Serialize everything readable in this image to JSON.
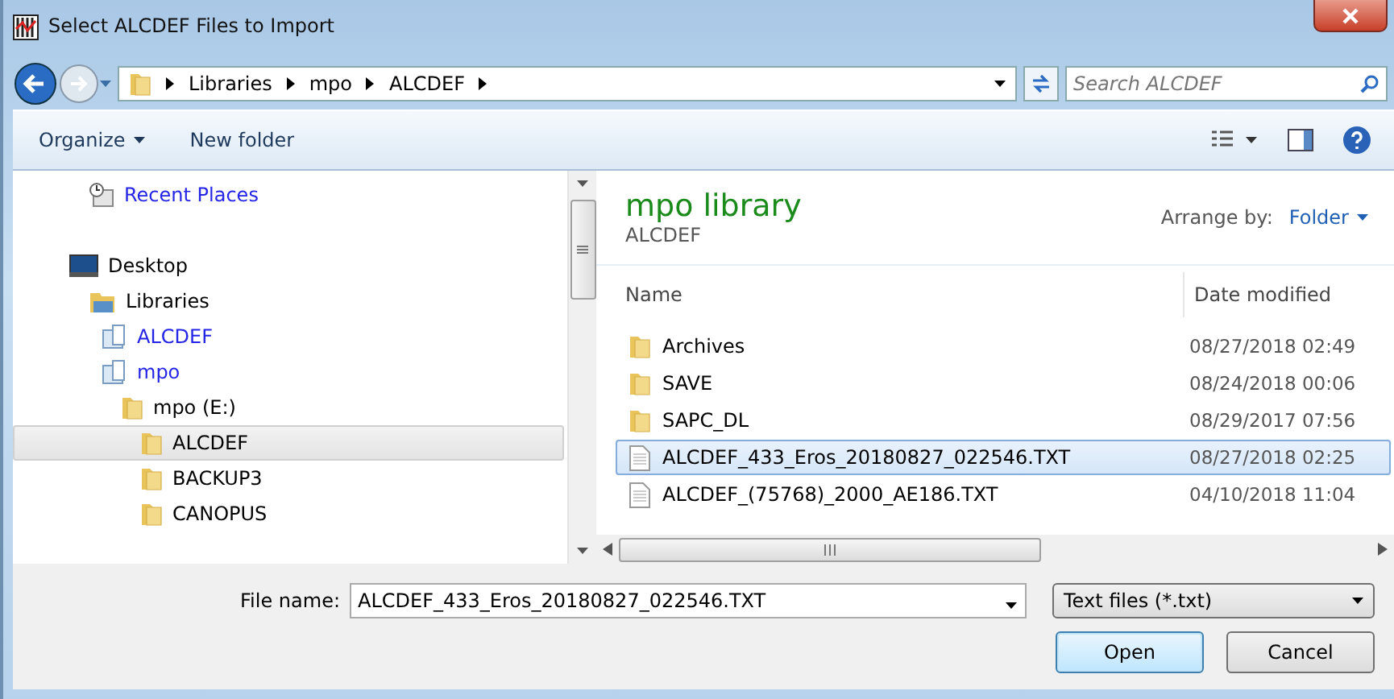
{
  "window": {
    "title": "Select ALCDEF Files to Import"
  },
  "address": {
    "segments": [
      "Libraries",
      "mpo",
      "ALCDEF"
    ]
  },
  "search": {
    "placeholder": "Search ALCDEF"
  },
  "toolbar": {
    "organize": "Organize",
    "new_folder": "New folder"
  },
  "nav_tree": [
    {
      "label": "Recent Places",
      "kind": "recent",
      "selected": false
    },
    {
      "label": "Desktop",
      "kind": "desktop",
      "selected": false,
      "children": [
        {
          "label": "Libraries",
          "kind": "libraries",
          "selected": false,
          "children": [
            {
              "label": "ALCDEF",
              "kind": "library",
              "selected": false
            },
            {
              "label": "mpo",
              "kind": "library",
              "selected": false,
              "children": [
                {
                  "label": "mpo (E:)",
                  "kind": "folder",
                  "selected": false,
                  "children": [
                    {
                      "label": "ALCDEF",
                      "kind": "folder",
                      "selected": true
                    },
                    {
                      "label": "BACKUP3",
                      "kind": "folder",
                      "selected": false
                    },
                    {
                      "label": "CANOPUS",
                      "kind": "folder",
                      "selected": false
                    }
                  ]
                }
              ]
            }
          ]
        }
      ]
    }
  ],
  "library_header": {
    "title": "mpo library",
    "subtitle": "ALCDEF",
    "arrange_label": "Arrange by:",
    "arrange_value": "Folder"
  },
  "columns": [
    "Name",
    "Date modified"
  ],
  "files": [
    {
      "name": "Archives",
      "date": "08/27/2018 02:49",
      "kind": "folder",
      "selected": false
    },
    {
      "name": "SAVE",
      "date": "08/24/2018 00:06",
      "kind": "folder",
      "selected": false
    },
    {
      "name": "SAPC_DL",
      "date": "08/29/2017 07:56",
      "kind": "folder",
      "selected": false
    },
    {
      "name": "ALCDEF_433_Eros_20180827_022546.TXT",
      "date": "08/27/2018 02:25",
      "kind": "file",
      "selected": true
    },
    {
      "name": "ALCDEF_(75768)_2000_AE186.TXT",
      "date": "04/10/2018 11:04",
      "kind": "file",
      "selected": false
    }
  ],
  "file_name": {
    "label": "File name:",
    "value": "ALCDEF_433_Eros_20180827_022546.TXT"
  },
  "file_type": {
    "value": "Text files (*.txt)"
  },
  "buttons": [
    {
      "label": "Open",
      "kind": "default"
    },
    {
      "label": "Cancel",
      "kind": "normal"
    }
  ]
}
